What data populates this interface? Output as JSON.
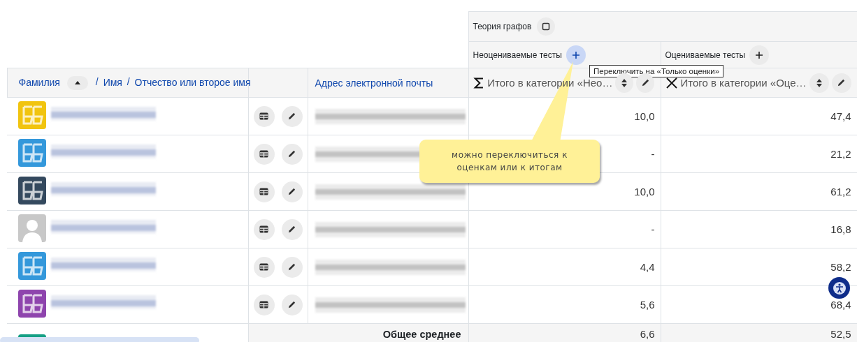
{
  "course": {
    "title": "Теория графов"
  },
  "categories": [
    {
      "title": "Неоцениваемые тесты",
      "highlighted": true
    },
    {
      "title": "Оцениваемые тесты",
      "highlighted": false
    }
  ],
  "tooltip": "Переключить на «Только оценки»",
  "name_header": {
    "sort_ascending": true,
    "parts": [
      {
        "kind": "link",
        "text": "Фамилия"
      },
      {
        "kind": "sep",
        "text": "/"
      },
      {
        "kind": "link",
        "text": "Имя"
      },
      {
        "kind": "sep",
        "text": "/"
      },
      {
        "kind": "link",
        "text": "Отчество или второе имя"
      }
    ]
  },
  "email_header": "Адрес электронной почты",
  "total_headers": [
    {
      "label": "Итого в категории «Нео…"
    },
    {
      "label": "Итого в категории «Оце…"
    }
  ],
  "rows": [
    {
      "avatar": {
        "kind": "monogram",
        "color": "#f1c40f"
      },
      "name_blurred": true,
      "email_blurred": true,
      "totals": [
        "10,0",
        "47,4"
      ]
    },
    {
      "avatar": {
        "kind": "monogram",
        "color": "#3498db"
      },
      "name_blurred": true,
      "email_blurred": true,
      "totals": [
        "-",
        "21,2"
      ]
    },
    {
      "avatar": {
        "kind": "monogram",
        "color": "#34495e"
      },
      "name_blurred": true,
      "email_blurred": true,
      "totals": [
        "10,0",
        "61,2"
      ]
    },
    {
      "avatar": {
        "kind": "silhouette",
        "color": "#c8c8c8"
      },
      "name_blurred": true,
      "email_blurred": true,
      "totals": [
        "-",
        "16,8"
      ]
    },
    {
      "avatar": {
        "kind": "monogram",
        "color": "#3498db"
      },
      "name_blurred": true,
      "email_blurred": true,
      "totals": [
        "4,4",
        "58,2"
      ]
    },
    {
      "avatar": {
        "kind": "monogram",
        "color": "#8e44ad"
      },
      "name_blurred": true,
      "email_blurred": true,
      "totals": [
        "5,6",
        "68,4"
      ]
    }
  ],
  "clipped_row": {
    "avatar": {
      "color": "#16a085"
    }
  },
  "overall": {
    "label": "Общее среднее",
    "values": [
      "6,6",
      "52,5"
    ]
  },
  "callout": {
    "text": "можно переключиться к оценкам или к итогам"
  }
}
